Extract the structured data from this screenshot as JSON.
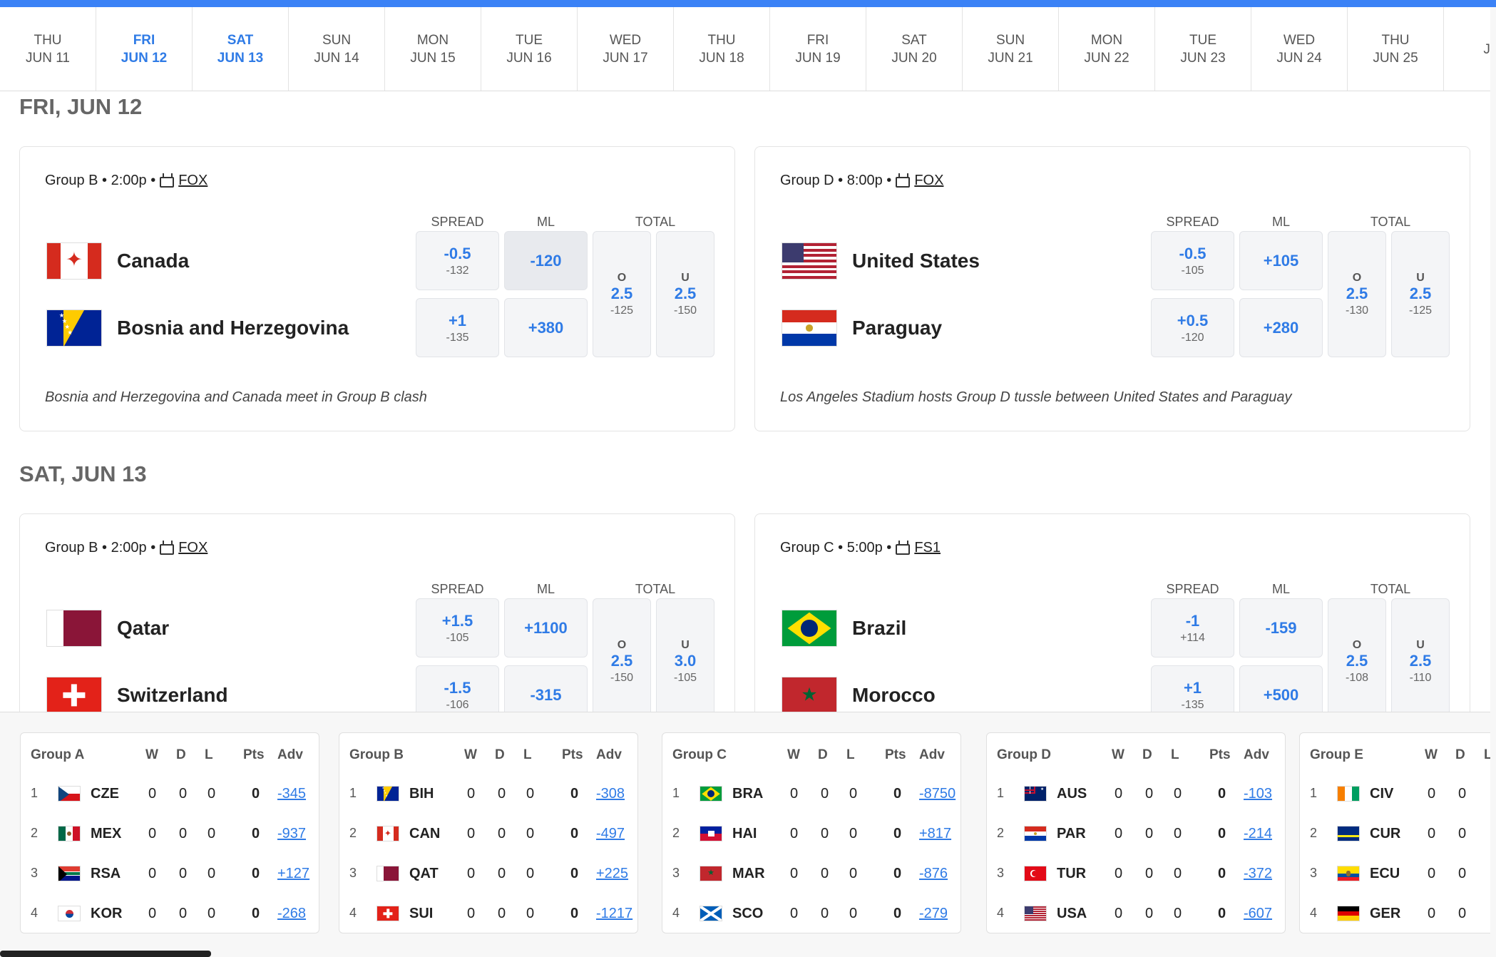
{
  "dates": [
    {
      "dow": "THU",
      "date": "JUN 11",
      "active": false
    },
    {
      "dow": "FRI",
      "date": "JUN 12",
      "active": true
    },
    {
      "dow": "SAT",
      "date": "JUN 13",
      "active": true
    },
    {
      "dow": "SUN",
      "date": "JUN 14",
      "active": false
    },
    {
      "dow": "MON",
      "date": "JUN 15",
      "active": false
    },
    {
      "dow": "TUE",
      "date": "JUN 16",
      "active": false
    },
    {
      "dow": "WED",
      "date": "JUN 17",
      "active": false
    },
    {
      "dow": "THU",
      "date": "JUN 18",
      "active": false
    },
    {
      "dow": "FRI",
      "date": "JUN 19",
      "active": false
    },
    {
      "dow": "SAT",
      "date": "JUN 20",
      "active": false
    },
    {
      "dow": "SUN",
      "date": "JUN 21",
      "active": false
    },
    {
      "dow": "MON",
      "date": "JUN 22",
      "active": false
    },
    {
      "dow": "TUE",
      "date": "JUN 23",
      "active": false
    },
    {
      "dow": "WED",
      "date": "JUN 24",
      "active": false
    },
    {
      "dow": "THU",
      "date": "JUN 25",
      "active": false
    },
    {
      "dow": "",
      "date": "JU",
      "active": false
    }
  ],
  "days": [
    {
      "heading": "FRI, JUN 12",
      "games": [
        {
          "meta": "Group B • 2:00p •",
          "network": "FOX",
          "headers": {
            "spread": "SPREAD",
            "ml": "ML",
            "total": "TOTAL"
          },
          "teams": [
            {
              "name": "Canada",
              "flag": "canada",
              "spread": "-0.5",
              "spread_odds": "-132",
              "ml": "-120",
              "ml_selected": true
            },
            {
              "name": "Bosnia and Herzegovina",
              "flag": "bosnia",
              "spread": "+1",
              "spread_odds": "-135",
              "ml": "+380",
              "ml_selected": false
            }
          ],
          "over": {
            "label": "O",
            "line": "2.5",
            "odds": "-125"
          },
          "under": {
            "label": "U",
            "line": "2.5",
            "odds": "-150"
          },
          "desc": "Bosnia and Herzegovina and Canada meet in Group B clash"
        },
        {
          "meta": "Group D • 8:00p •",
          "network": "FOX",
          "headers": {
            "spread": "SPREAD",
            "ml": "ML",
            "total": "TOTAL"
          },
          "teams": [
            {
              "name": "United States",
              "flag": "usa",
              "spread": "-0.5",
              "spread_odds": "-105",
              "ml": "+105",
              "ml_selected": false
            },
            {
              "name": "Paraguay",
              "flag": "paraguay",
              "spread": "+0.5",
              "spread_odds": "-120",
              "ml": "+280",
              "ml_selected": false
            }
          ],
          "over": {
            "label": "O",
            "line": "2.5",
            "odds": "-130"
          },
          "under": {
            "label": "U",
            "line": "2.5",
            "odds": "-125"
          },
          "desc": "Los Angeles Stadium hosts Group D tussle between United States and Paraguay"
        }
      ]
    },
    {
      "heading": "SAT, JUN 13",
      "games": [
        {
          "meta": "Group B • 2:00p •",
          "network": "FOX",
          "headers": {
            "spread": "SPREAD",
            "ml": "ML",
            "total": "TOTAL"
          },
          "teams": [
            {
              "name": "Qatar",
              "flag": "qatar",
              "spread": "+1.5",
              "spread_odds": "-105",
              "ml": "+1100",
              "ml_selected": false
            },
            {
              "name": "Switzerland",
              "flag": "switzerland",
              "spread": "-1.5",
              "spread_odds": "-106",
              "ml": "-315",
              "ml_selected": false
            }
          ],
          "over": {
            "label": "O",
            "line": "2.5",
            "odds": "-150"
          },
          "under": {
            "label": "U",
            "line": "3.0",
            "odds": "-105"
          },
          "desc": ""
        },
        {
          "meta": "Group C • 5:00p •",
          "network": "FS1",
          "headers": {
            "spread": "SPREAD",
            "ml": "ML",
            "total": "TOTAL"
          },
          "teams": [
            {
              "name": "Brazil",
              "flag": "brazil",
              "spread": "-1",
              "spread_odds": "+114",
              "ml": "-159",
              "ml_selected": false
            },
            {
              "name": "Morocco",
              "flag": "morocco",
              "spread": "+1",
              "spread_odds": "-135",
              "ml": "+500",
              "ml_selected": false
            }
          ],
          "over": {
            "label": "O",
            "line": "2.5",
            "odds": "-108"
          },
          "under": {
            "label": "U",
            "line": "2.5",
            "odds": "-110"
          },
          "desc": ""
        }
      ]
    }
  ],
  "standings_headers": {
    "w": "W",
    "d": "D",
    "l": "L",
    "pts": "Pts",
    "adv": "Adv"
  },
  "groups": [
    {
      "name": "Group A",
      "rows": [
        {
          "rank": "1",
          "flag": "czechia",
          "abbr": "CZE",
          "w": "0",
          "d": "0",
          "l": "0",
          "pts": "0",
          "adv": "-345"
        },
        {
          "rank": "2",
          "flag": "mexico",
          "abbr": "MEX",
          "w": "0",
          "d": "0",
          "l": "0",
          "pts": "0",
          "adv": "-937"
        },
        {
          "rank": "3",
          "flag": "southafrica",
          "abbr": "RSA",
          "w": "0",
          "d": "0",
          "l": "0",
          "pts": "0",
          "adv": "+127"
        },
        {
          "rank": "4",
          "flag": "korea",
          "abbr": "KOR",
          "w": "0",
          "d": "0",
          "l": "0",
          "pts": "0",
          "adv": "-268"
        }
      ]
    },
    {
      "name": "Group B",
      "rows": [
        {
          "rank": "1",
          "flag": "bosnia",
          "abbr": "BIH",
          "w": "0",
          "d": "0",
          "l": "0",
          "pts": "0",
          "adv": "-308"
        },
        {
          "rank": "2",
          "flag": "canada",
          "abbr": "CAN",
          "w": "0",
          "d": "0",
          "l": "0",
          "pts": "0",
          "adv": "-497"
        },
        {
          "rank": "3",
          "flag": "qatar",
          "abbr": "QAT",
          "w": "0",
          "d": "0",
          "l": "0",
          "pts": "0",
          "adv": "+225"
        },
        {
          "rank": "4",
          "flag": "switzerland",
          "abbr": "SUI",
          "w": "0",
          "d": "0",
          "l": "0",
          "pts": "0",
          "adv": "-1217"
        }
      ]
    },
    {
      "name": "Group C",
      "rows": [
        {
          "rank": "1",
          "flag": "brazil",
          "abbr": "BRA",
          "w": "0",
          "d": "0",
          "l": "0",
          "pts": "0",
          "adv": "-8750"
        },
        {
          "rank": "2",
          "flag": "haiti",
          "abbr": "HAI",
          "w": "0",
          "d": "0",
          "l": "0",
          "pts": "0",
          "adv": "+817"
        },
        {
          "rank": "3",
          "flag": "morocco",
          "abbr": "MAR",
          "w": "0",
          "d": "0",
          "l": "0",
          "pts": "0",
          "adv": "-876"
        },
        {
          "rank": "4",
          "flag": "scotland",
          "abbr": "SCO",
          "w": "0",
          "d": "0",
          "l": "0",
          "pts": "0",
          "adv": "-279"
        }
      ]
    },
    {
      "name": "Group D",
      "rows": [
        {
          "rank": "1",
          "flag": "australia",
          "abbr": "AUS",
          "w": "0",
          "d": "0",
          "l": "0",
          "pts": "0",
          "adv": "-103"
        },
        {
          "rank": "2",
          "flag": "paraguay",
          "abbr": "PAR",
          "w": "0",
          "d": "0",
          "l": "0",
          "pts": "0",
          "adv": "-214"
        },
        {
          "rank": "3",
          "flag": "turkey",
          "abbr": "TUR",
          "w": "0",
          "d": "0",
          "l": "0",
          "pts": "0",
          "adv": "-372"
        },
        {
          "rank": "4",
          "flag": "usa",
          "abbr": "USA",
          "w": "0",
          "d": "0",
          "l": "0",
          "pts": "0",
          "adv": "-607"
        }
      ]
    },
    {
      "name": "Group E",
      "rows": [
        {
          "rank": "1",
          "flag": "ivorycoast",
          "abbr": "CIV",
          "w": "0",
          "d": "0",
          "l": "",
          "pts": "",
          "adv": ""
        },
        {
          "rank": "2",
          "flag": "curacao",
          "abbr": "CUR",
          "w": "0",
          "d": "0",
          "l": "",
          "pts": "",
          "adv": ""
        },
        {
          "rank": "3",
          "flag": "ecuador",
          "abbr": "ECU",
          "w": "0",
          "d": "0",
          "l": "",
          "pts": "",
          "adv": ""
        },
        {
          "rank": "4",
          "flag": "germany",
          "abbr": "GER",
          "w": "0",
          "d": "0",
          "l": "",
          "pts": "",
          "adv": ""
        }
      ]
    }
  ],
  "colors": {
    "accent": "#2f7be6",
    "topbar": "#3b82f6"
  }
}
